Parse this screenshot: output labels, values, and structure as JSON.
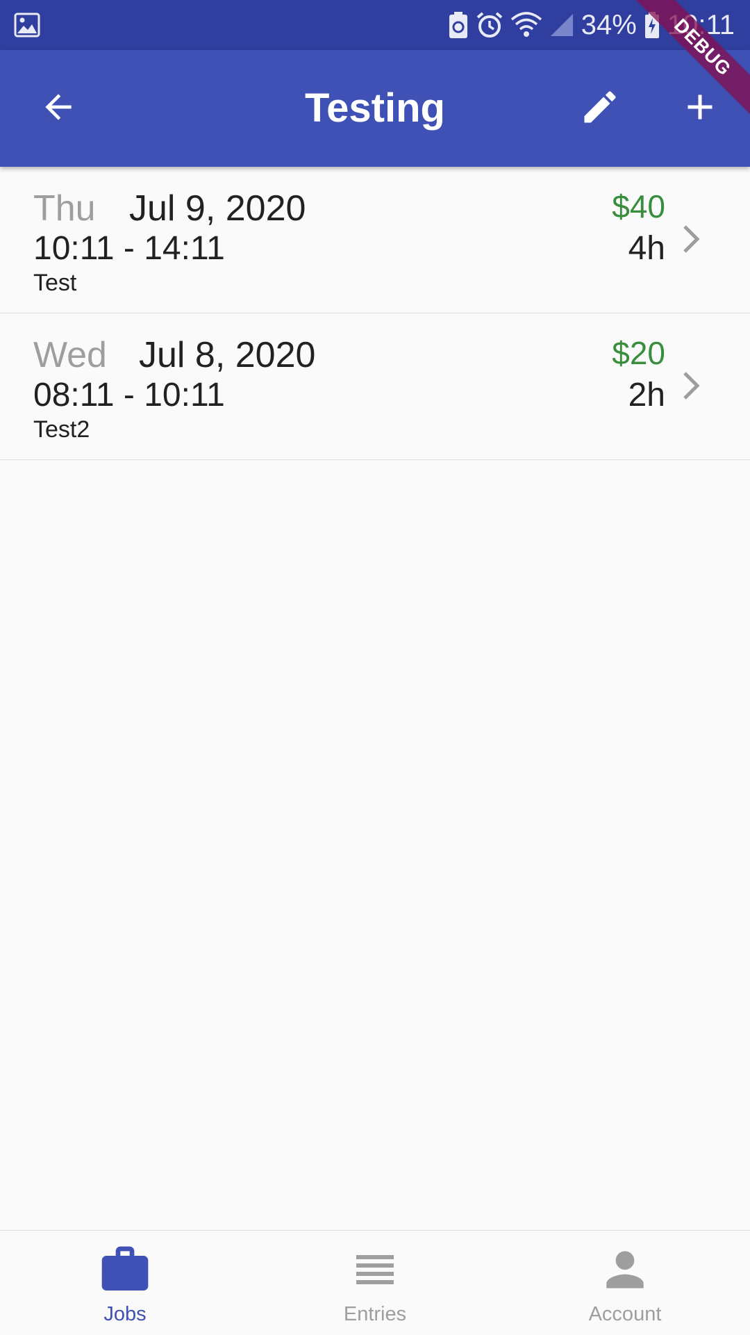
{
  "status_bar": {
    "battery": "34%",
    "time": "10:11",
    "icons": [
      "image-icon",
      "battery-saver-icon",
      "alarm-icon",
      "wifi-icon",
      "signal-icon",
      "battery-charging-icon"
    ]
  },
  "app_bar": {
    "title": "Testing",
    "icons": {
      "back": "arrow-back-icon",
      "edit": "edit-pencil-icon",
      "add": "add-icon"
    },
    "color": "#3f51b5"
  },
  "debug_banner": {
    "label": "DEBUG",
    "color": "#880e4f"
  },
  "entries": [
    {
      "day": "Thu",
      "date": "Jul 9, 2020",
      "time_range": "10:11 - 14:11",
      "comment": "Test",
      "pay": "$40",
      "duration": "4h"
    },
    {
      "day": "Wed",
      "date": "Jul 8, 2020",
      "time_range": "08:11 - 10:11",
      "comment": "Test2",
      "pay": "$20",
      "duration": "2h"
    }
  ],
  "bottom_nav": {
    "items": [
      {
        "label": "Jobs",
        "icon": "briefcase-icon",
        "active": true
      },
      {
        "label": "Entries",
        "icon": "list-icon",
        "active": false
      },
      {
        "label": "Account",
        "icon": "person-icon",
        "active": false
      }
    ],
    "active_color": "#3f51b5",
    "inactive_color": "#9e9e9e"
  },
  "colors": {
    "pay": "#388e3c",
    "status_bar": "#303f9f"
  }
}
